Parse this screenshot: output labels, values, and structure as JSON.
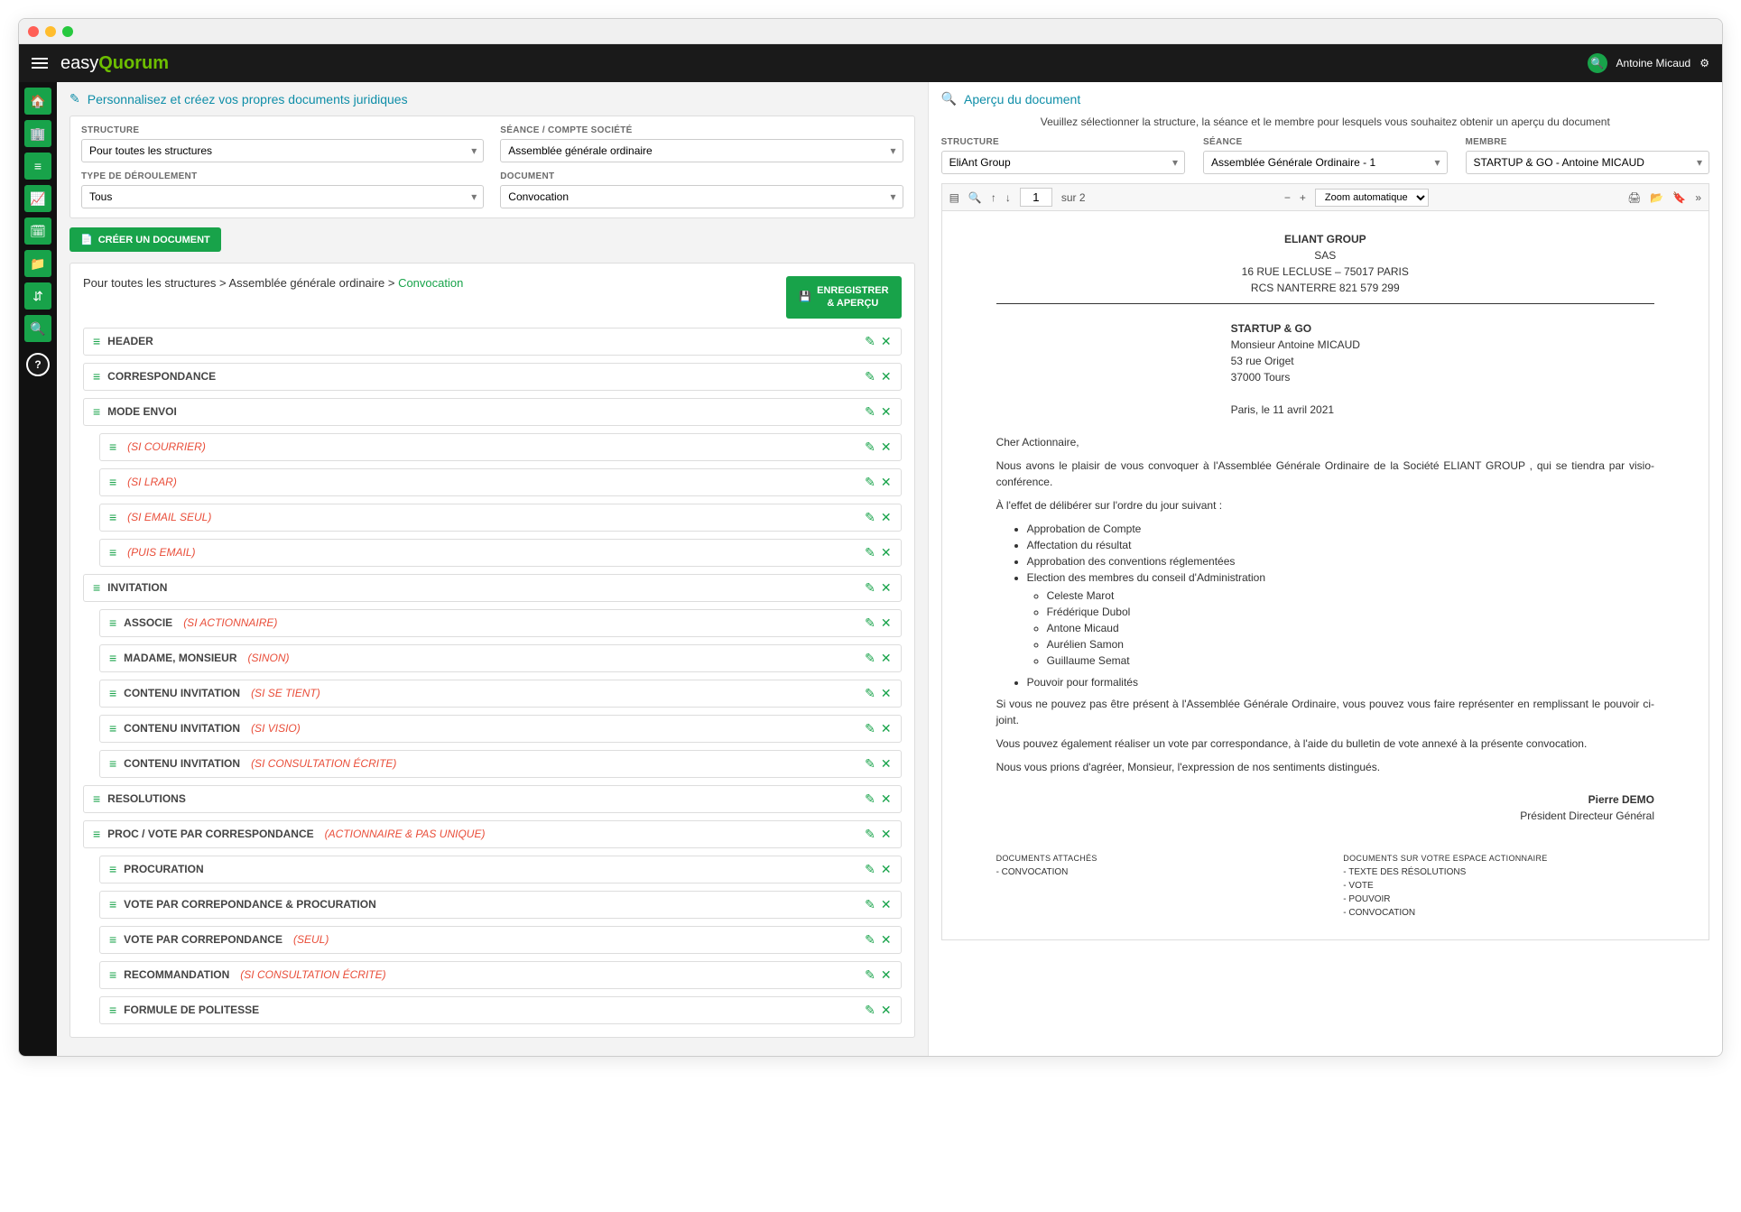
{
  "topbar": {
    "logo_prefix": "easy",
    "logo_suffix": "Quorum",
    "user_name": "Antoine Micaud"
  },
  "left": {
    "title": "Personnalisez et créez vos propres documents juridiques",
    "filters": {
      "structure_label": "STRUCTURE",
      "structure_value": "Pour toutes les structures",
      "seance_label": "SÉANCE / COMPTE SOCIÉTÉ",
      "seance_value": "Assemblée générale ordinaire",
      "type_label": "TYPE DE DÉROULEMENT",
      "type_value": "Tous",
      "document_label": "DOCUMENT",
      "document_value": "Convocation"
    },
    "create_btn": "CRÉER UN DOCUMENT",
    "breadcrumb": {
      "p1": "Pour toutes les structures",
      "p2": "Assemblée générale ordinaire",
      "p3": "Convocation"
    },
    "save_btn_l1": "ENREGISTRER",
    "save_btn_l2": "& APERÇU",
    "blocks": {
      "header": "HEADER",
      "correspondance": "CORRESPONDANCE",
      "mode_envoi": "MODE ENVOI",
      "si_courrier": "(SI COURRIER)",
      "si_lrar": "(SI LRAR)",
      "si_email_seul": "(SI EMAIL SEUL)",
      "puis_email": "(PUIS EMAIL)",
      "invitation": "INVITATION",
      "associe": "ASSOCIE",
      "associe_cond": "(SI ACTIONNAIRE)",
      "madame": "MADAME, MONSIEUR",
      "madame_cond": "(SINON)",
      "contenu1": "CONTENU INVITATION",
      "contenu1_cond": "(SI SE TIENT)",
      "contenu2": "CONTENU INVITATION",
      "contenu2_cond": "(SI VISIO)",
      "contenu3": "CONTENU INVITATION",
      "contenu3_cond": "(SI CONSULTATION ÉCRITE)",
      "resolutions": "RESOLUTIONS",
      "proc_vote": "PROC / VOTE PAR CORRESPONDANCE",
      "proc_vote_cond": "(ACTIONNAIRE & PAS UNIQUE)",
      "procuration": "PROCURATION",
      "vote_proc": "VOTE PAR CORREPONDANCE & PROCURATION",
      "vote_corr": "VOTE PAR CORREPONDANCE",
      "vote_corr_cond": "(SEUL)",
      "recomm": "RECOMMANDATION",
      "recomm_cond": "(SI CONSULTATION ÉCRITE)",
      "formule": "FORMULE DE POLITESSE"
    }
  },
  "right": {
    "title": "Aperçu du document",
    "instr": "Veuillez sélectionner la structure, la séance et le membre pour lesquels vous souhaitez obtenir un aperçu du document",
    "filters": {
      "structure_label": "STRUCTURE",
      "structure_value": "EliAnt Group",
      "seance_label": "SÉANCE",
      "seance_value": "Assemblée Générale Ordinaire - 1",
      "membre_label": "MEMBRE",
      "membre_value": "STARTUP & GO - Antoine MICAUD"
    },
    "pdfbar": {
      "page": "1",
      "total": "sur 2",
      "zoom": "Zoom automatique"
    },
    "doc": {
      "company": "ELIANT GROUP",
      "form": "SAS",
      "addr1": "16 RUE LECLUSE – 75017 PARIS",
      "addr2": "RCS NANTERRE 821 579 299",
      "dest_company": "STARTUP & GO",
      "dest_name": "Monsieur Antoine MICAUD",
      "dest_street": "53 rue Origet",
      "dest_city": "37000 Tours",
      "date": "Paris, le 11 avril 2021",
      "salut": "Cher Actionnaire,",
      "p1": "Nous avons le plaisir de vous convoquer à l'Assemblée Générale Ordinaire de la Société ELIANT GROUP , qui se tiendra par visio-conférence.",
      "p2": "À l'effet de délibérer sur l'ordre du jour suivant :",
      "li1": "Approbation de Compte",
      "li2": "Affectation du résultat",
      "li3": "Approbation des conventions réglementées",
      "li4": "Election des membres du conseil d'Administration",
      "li4a": "Celeste Marot",
      "li4b": "Frédérique Dubol",
      "li4c": "Antone Micaud",
      "li4d": "Aurélien Samon",
      "li4e": "Guillaume Semat",
      "li5": "Pouvoir pour formalités",
      "p3": "Si vous ne pouvez pas être présent à l'Assemblée Générale Ordinaire, vous pouvez vous faire représenter en remplissant le pouvoir ci-joint.",
      "p4": "Vous pouvez également réaliser un vote par correspondance, à l'aide du bulletin de vote annexé à la présente convocation.",
      "p5": "Nous vous prions d'agréer, Monsieur, l'expression de nos sentiments distingués.",
      "sig_name": "Pierre DEMO",
      "sig_title": "Président Directeur Général",
      "att1_title": "DOCUMENTS ATTACHÉS",
      "att1_1": "- CONVOCATION",
      "att2_title": "DOCUMENTS SUR VOTRE ESPACE ACTIONNAIRE",
      "att2_1": "- TEXTE DES RÉSOLUTIONS",
      "att2_2": "- VOTE",
      "att2_3": "- POUVOIR",
      "att2_4": "- CONVOCATION"
    }
  }
}
